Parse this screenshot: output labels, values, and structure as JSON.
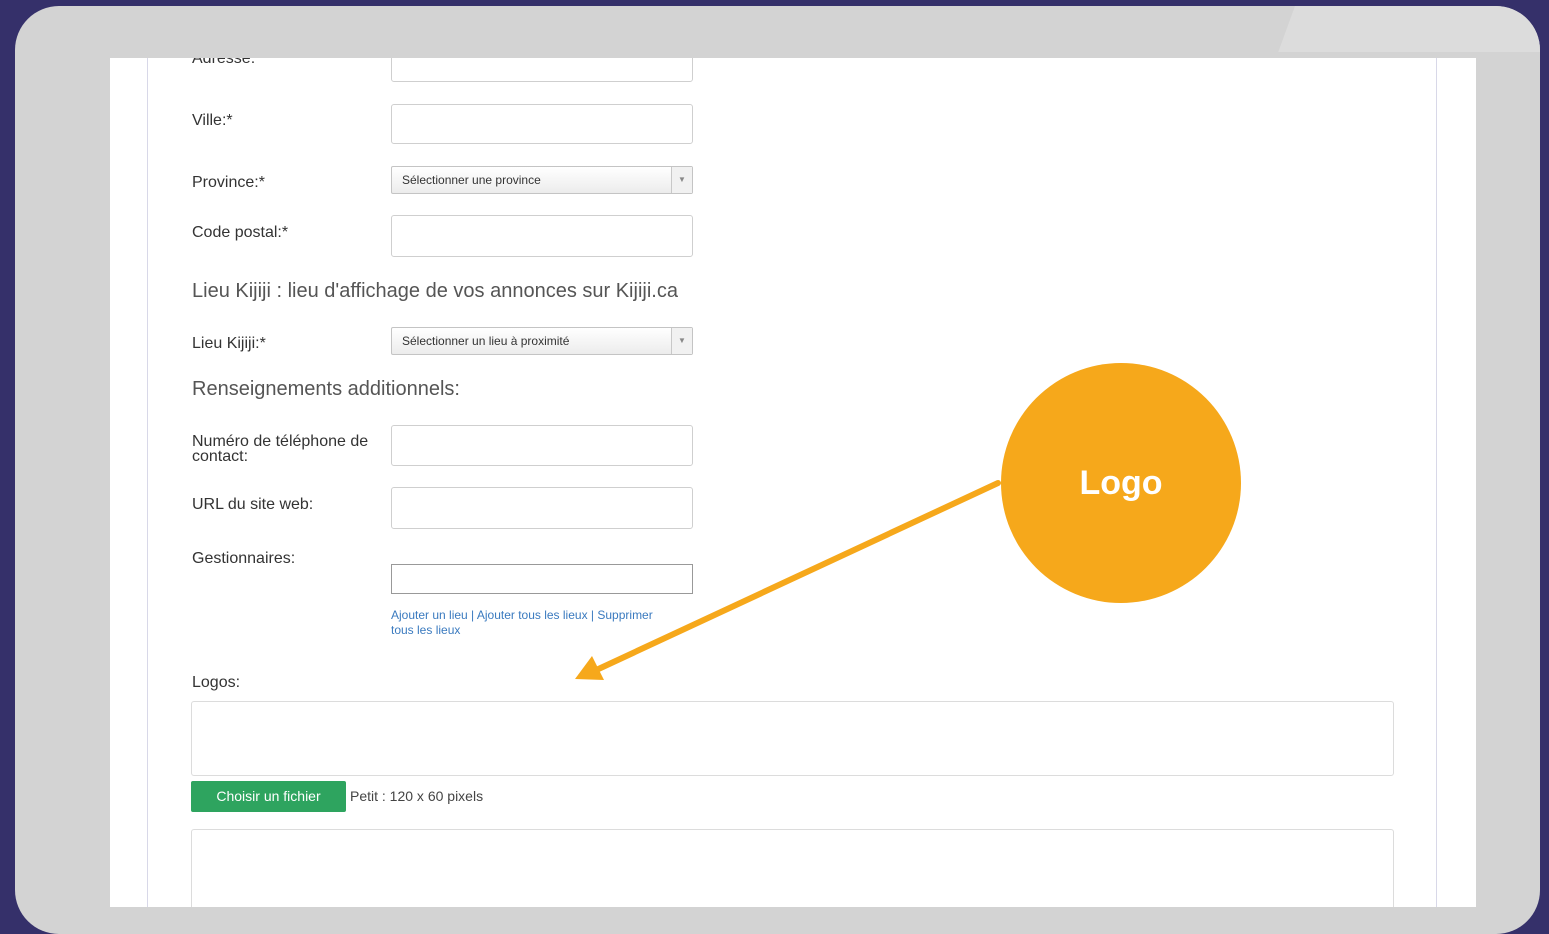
{
  "form": {
    "adresse_label": "Adresse:",
    "ville_label": "Ville:*",
    "province_label": "Province:*",
    "province_value": "Sélectionner une province",
    "code_postal_label": "Code postal:*",
    "lieu_section_title": "Lieu Kijiji : lieu d'affichage de vos annonces sur Kijiji.ca",
    "lieu_label": "Lieu Kijiji:*",
    "lieu_value": "Sélectionner un lieu à proximité",
    "additional_title": "Renseignements additionnels:",
    "phone_label_line1": "Numéro de téléphone de",
    "phone_label_line2": "contact:",
    "website_label": "URL du site web:",
    "managers_label": "Gestionnaires:",
    "link_add_place": "Ajouter un lieu",
    "link_add_all": "Ajouter tous les lieux",
    "link_remove_all_line1": "Supprimer",
    "link_remove_all_line2": "tous les lieux",
    "link_separator": " | ",
    "logos_label": "Logos:",
    "choose_file_label": "Choisir un fichier",
    "logo_size_hint": "Petit : 120 x 60 pixels"
  },
  "annotation": {
    "text": "Logo",
    "color": "#f6a81b"
  },
  "colors": {
    "background": "#35306a",
    "frame": "#d3d3d3",
    "button": "#2ea45f",
    "link": "#3a7abf"
  }
}
